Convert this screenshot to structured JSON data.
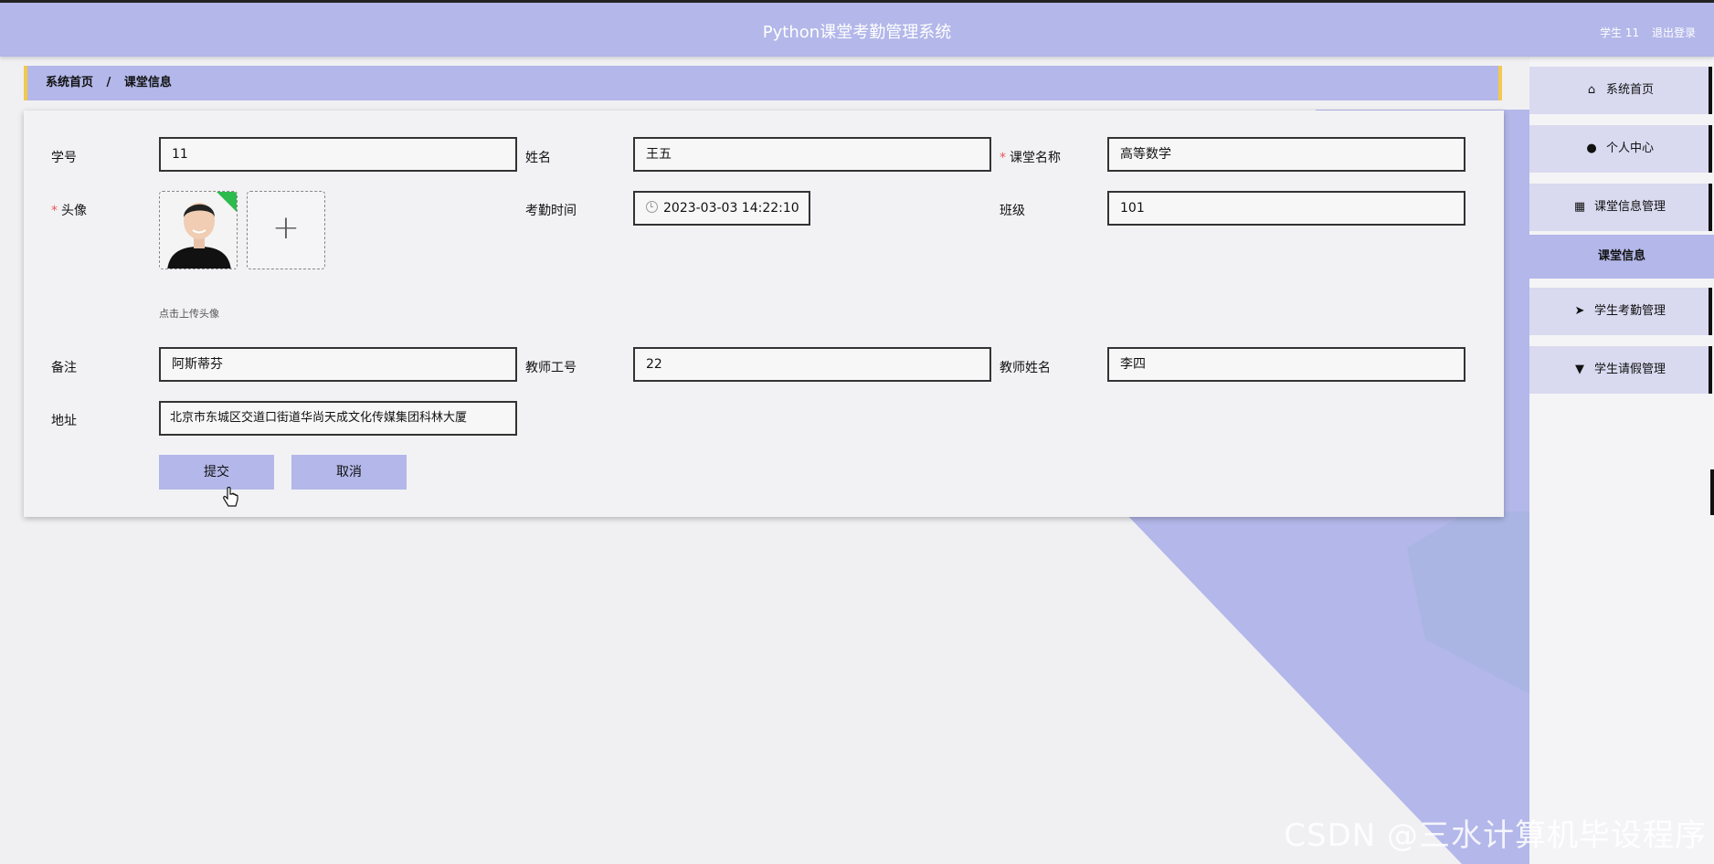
{
  "header": {
    "title": "Python课堂考勤管理系统",
    "user": "学生 11",
    "logout": "退出登录"
  },
  "breadcrumb": {
    "home": "系统首页",
    "separator": "/",
    "current": "课堂信息"
  },
  "form": {
    "student_no": {
      "label": "学号",
      "value": "11"
    },
    "name": {
      "label": "姓名",
      "value": "王五"
    },
    "course_name": {
      "label": "课堂名称",
      "value": "高等数学"
    },
    "avatar": {
      "label": "头像",
      "hint": "点击上传头像"
    },
    "attendance_time": {
      "label": "考勤时间",
      "value": "2023-03-03 14:22:10"
    },
    "class": {
      "label": "班级",
      "value": "101"
    },
    "remark": {
      "label": "备注",
      "value": "阿斯蒂芬"
    },
    "teacher_no": {
      "label": "教师工号",
      "value": "22"
    },
    "teacher_name": {
      "label": "教师姓名",
      "value": "李四"
    },
    "address": {
      "label": "地址",
      "value": "北京市东城区交道口街道华尚天成文化传媒集团科林大厦"
    },
    "required_mark": "*",
    "upload_plus": "+",
    "submit": "提交",
    "cancel": "取消"
  },
  "sidebar": {
    "items": [
      {
        "label": "系统首页",
        "icon": "home-icon"
      },
      {
        "label": "个人中心",
        "icon": "user-icon"
      },
      {
        "label": "课堂信息管理",
        "icon": "grid-icon"
      },
      {
        "label": "学生考勤管理",
        "icon": "send-icon"
      },
      {
        "label": "学生请假管理",
        "icon": "brush-icon"
      }
    ],
    "sub_item": "课堂信息"
  },
  "watermark": "CSDN @三水计算机毕设程序",
  "colors": {
    "accent": "#b3b7e9",
    "breadcrumb_border": "#f2c94c",
    "background": "#f0f0f3"
  }
}
